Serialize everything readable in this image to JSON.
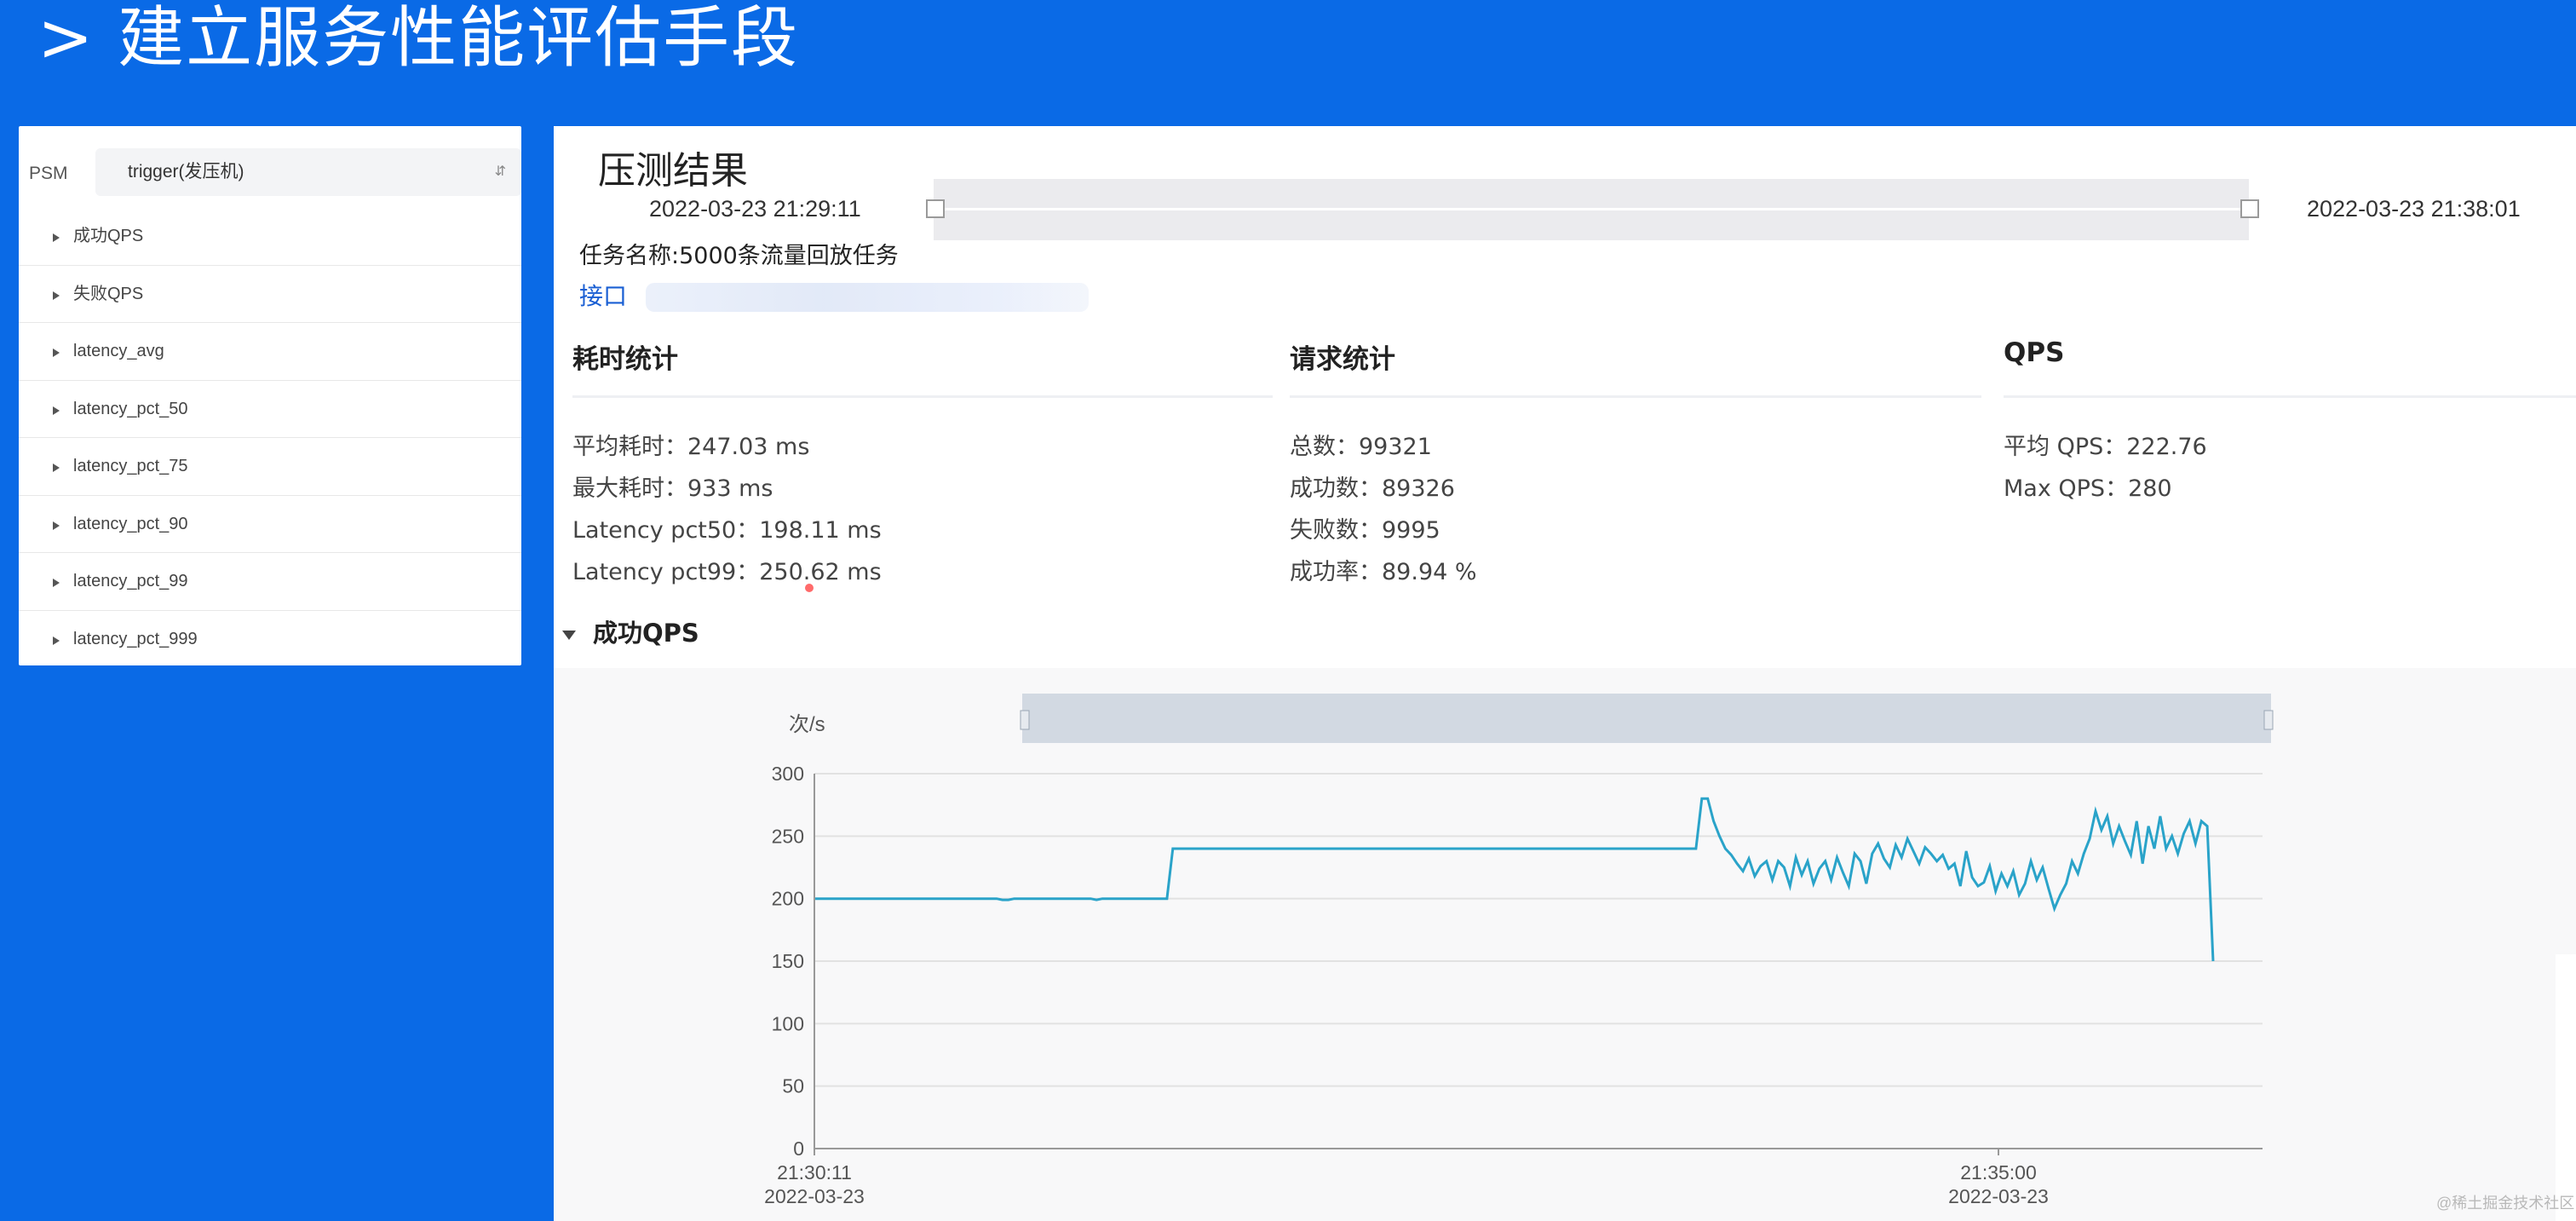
{
  "slide": {
    "title": "> 建立服务性能评估手段"
  },
  "left_panel": {
    "psm_label": "PSM",
    "psm_value": "trigger(发压机)",
    "metrics": [
      "成功QPS",
      "失败QPS",
      "latency_avg",
      "latency_pct_50",
      "latency_pct_75",
      "latency_pct_90",
      "latency_pct_99",
      "latency_pct_999"
    ]
  },
  "main": {
    "title": "压测结果",
    "range_start": "2022-03-23 21:29:11",
    "range_end": "2022-03-23 21:38:01",
    "task_name": "任务名称:5000条流量回放任务",
    "interface_label": "接口"
  },
  "stats": {
    "latency": {
      "heading": "耗时统计",
      "lines": [
        "平均耗时：247.03 ms",
        "最大耗时：933 ms",
        "Latency pct50：198.11 ms",
        "Latency pct99：250.62 ms"
      ]
    },
    "requests": {
      "heading": "请求统计",
      "lines": [
        "总数：99321",
        "成功数：89326",
        "失败数：9995",
        "成功率：89.94 %"
      ]
    },
    "qps": {
      "heading": "QPS",
      "lines": [
        "平均 QPS：222.76",
        "Max QPS：280"
      ]
    }
  },
  "section": {
    "title": "成功QPS"
  },
  "footer": {
    "watermark": "@稀土掘金技术社区"
  },
  "colors": {
    "background": "#0a6ae6",
    "line": "#2aa3c9"
  },
  "chart_data": {
    "type": "line",
    "ylabel": "次/s",
    "ylim": [
      0,
      300
    ],
    "yticks": [
      0,
      50,
      100,
      150,
      200,
      250,
      300
    ],
    "x_tick_labels": [
      {
        "time": "21:30:11",
        "date": "2022-03-23"
      },
      {
        "time": "21:35:00",
        "date": "2022-03-23"
      }
    ],
    "grid": true,
    "series": [
      {
        "values": [
          200,
          200,
          200,
          200,
          200,
          200,
          200,
          200,
          200,
          200,
          200,
          200,
          200,
          200,
          200,
          200,
          200,
          200,
          200,
          200,
          200,
          200,
          200,
          200,
          200,
          200,
          200,
          200,
          200,
          200,
          200,
          200,
          199,
          199,
          200,
          200,
          200,
          200,
          200,
          200,
          200,
          200,
          200,
          200,
          200,
          200,
          200,
          200,
          199,
          200,
          200,
          200,
          200,
          200,
          200,
          200,
          200,
          200,
          200,
          200,
          200,
          240,
          240,
          240,
          240,
          240,
          240,
          240,
          240,
          240,
          240,
          240,
          240,
          240,
          240,
          240,
          240,
          240,
          240,
          240,
          240,
          240,
          240,
          240,
          240,
          240,
          240,
          240,
          240,
          240,
          240,
          240,
          240,
          240,
          240,
          240,
          240,
          240,
          240,
          240,
          240,
          240,
          240,
          240,
          240,
          240,
          240,
          240,
          240,
          240,
          240,
          240,
          240,
          240,
          240,
          240,
          240,
          240,
          240,
          240,
          240,
          240,
          240,
          240,
          240,
          240,
          240,
          240,
          240,
          240,
          240,
          240,
          240,
          240,
          240,
          240,
          240,
          240,
          240,
          240,
          240,
          240,
          240,
          240,
          240,
          240,
          240,
          240,
          240,
          240,
          240,
          280,
          280,
          262,
          250,
          240,
          235,
          228,
          222,
          232,
          218,
          226,
          230,
          215,
          230,
          225,
          210,
          233,
          219,
          230,
          212,
          224,
          230,
          215,
          233,
          221,
          210,
          236,
          230,
          212,
          236,
          244,
          232,
          225,
          243,
          233,
          248,
          238,
          228,
          241,
          236,
          230,
          235,
          224,
          228,
          210,
          238,
          217,
          210,
          213,
          226,
          206,
          220,
          210,
          222,
          203,
          212,
          230,
          215,
          225,
          208,
          192,
          203,
          212,
          230,
          220,
          236,
          248,
          270,
          255,
          266,
          244,
          258,
          246,
          235,
          262,
          228,
          258,
          240,
          266,
          240,
          250,
          236,
          252,
          262,
          244,
          262,
          258,
          150
        ]
      }
    ]
  }
}
